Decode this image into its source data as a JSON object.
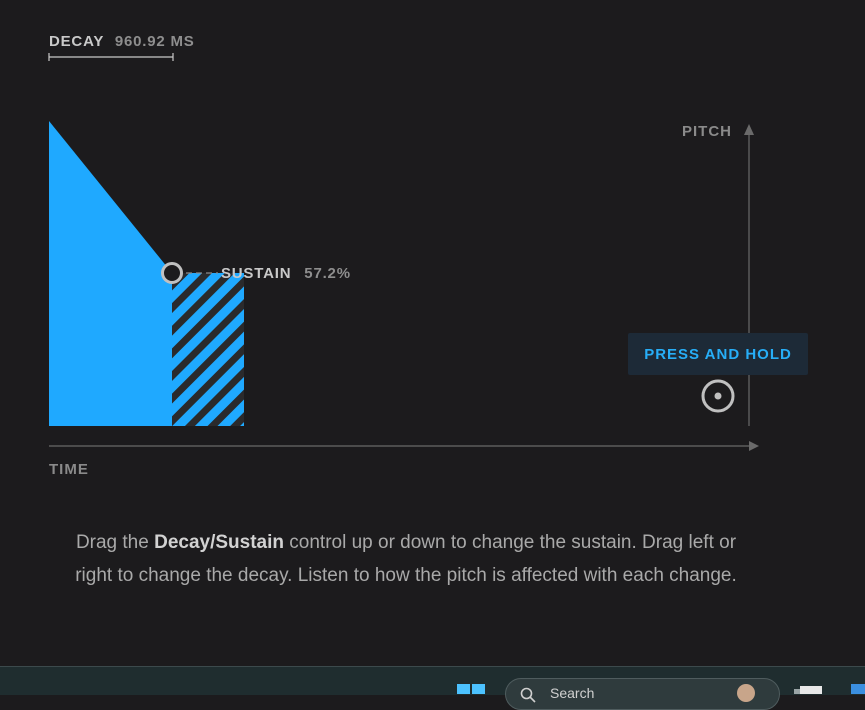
{
  "decay": {
    "label": "DECAY",
    "value": "960.92 MS"
  },
  "sustain": {
    "label": "SUSTAIN",
    "value": "57.2%"
  },
  "axes": {
    "pitch_label": "PITCH",
    "time_label": "TIME"
  },
  "press_hold": {
    "label": "PRESS AND HOLD"
  },
  "instructions": {
    "part1": "Drag the ",
    "bold": "Decay/Sustain",
    "part2": " control up or down to change the sustain. Drag left or right to change the decay. Listen to how the pitch is affected with each change."
  },
  "taskbar": {
    "search_text": "Search"
  },
  "colors": {
    "background": "#1c1b1d",
    "accent": "#1fa9ff",
    "stripe": "#2a2a2c",
    "label": "#c9c9c9",
    "muted": "#8e8e8e",
    "axis": "#6a6a6a"
  }
}
